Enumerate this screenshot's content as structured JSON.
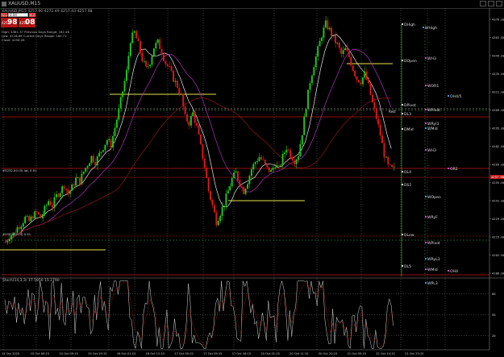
{
  "window": {
    "title": "XAUUSD,M15",
    "ohlc_line": "XAUUSD,M15  4257.90 4272.49 4257.43 4257.98"
  },
  "trade_panel": {
    "sell_label": "SELL",
    "buy_label": "BUY",
    "lot_value": "0.04",
    "sell_price_small": "4257",
    "sell_price_big": "98",
    "buy_price_small": "4258",
    "buy_price_big": "08",
    "info_lines": [
      "High: 4381.37    Previous Days Range: 162.46",
      "Low: 4216.89     Current Days Range: 160.71",
      "Close: 4256.28"
    ]
  },
  "price_axis": {
    "ticks": [
      "4376.00",
      "4362.00",
      "4349.00",
      "4335.00",
      "4321.00",
      "4309.00",
      "4295.00",
      "4282.00",
      "4269.00",
      "4255.00",
      "4241.00",
      "4229.00",
      "4215.00",
      "4202.00",
      "4188.00"
    ],
    "bid_label": "4257.98"
  },
  "time_axis": {
    "ticks": [
      "14 Oct 2025",
      "15 Oct 00:15",
      "15 Oct 09:15",
      "15 Oct 19:15",
      "16 Oct 01:15",
      "16 Oct 12:15",
      "17 Oct 00:15",
      "17 Oct 09:15",
      "17 Oct 18:15",
      "20 Oct 01:15",
      "20 Oct 11:15",
      "20 Oct 20:15",
      "21 Oct 05:15",
      "21 Oct 14:15",
      "21 Oct 23:15"
    ]
  },
  "level_labels": {
    "left": [
      "DHigh",
      "DOpen",
      "DPivot",
      "DL3",
      "DMid",
      "DL4",
      "DS1",
      "DLow",
      "DL5"
    ],
    "right": [
      "WHigh",
      "WH3",
      "WOR1",
      "OH4/5",
      "WPivot",
      "WRyl3",
      "WMid",
      "WH3",
      "OR2",
      "WOpen",
      "WRyF",
      "WPivot",
      "WRyL3",
      "WMid",
      "OH4",
      "WPL3"
    ],
    "mid": [
      "Rest"
    ]
  },
  "annotations": {
    "left_level_1": "#5232.00 (0) lot: 0.91",
    "left_level_2": "#5552.00 (0) 0.91"
  },
  "indicator": {
    "label": "Stoch(14,3,3) 17.5850 15.2790",
    "ticks": [
      "80",
      "50",
      "20"
    ]
  },
  "colors": {
    "bull": "#1fc91f",
    "bear": "#e01818",
    "ma_white": "#e6e6e6",
    "ma_violet": "#b030c0",
    "ma_darkred": "#8b1a1a",
    "yellow": "#e8e84a",
    "green_line": "#2e9e2e"
  },
  "chart_data": {
    "type": "candlestick",
    "ylim": [
      4170,
      4390
    ],
    "close_path": [
      4198,
      4203,
      4205,
      4210,
      4213,
      4218,
      4215,
      4220,
      4222,
      4218,
      4225,
      4232,
      4228,
      4236,
      4240,
      4245,
      4238,
      4243,
      4250,
      4248,
      4256,
      4262,
      4268,
      4264,
      4270,
      4276,
      4282,
      4278,
      4292,
      4306,
      4322,
      4338,
      4364,
      4370,
      4360,
      4348,
      4340,
      4346,
      4358,
      4362,
      4354,
      4345,
      4340,
      4332,
      4326,
      4318,
      4300,
      4296,
      4304,
      4292,
      4276,
      4260,
      4240,
      4228,
      4215,
      4222,
      4230,
      4240,
      4250,
      4255,
      4246,
      4240,
      4248,
      4258,
      4264,
      4268,
      4264,
      4258,
      4256,
      4262,
      4258,
      4268,
      4276,
      4270,
      4265,
      4270,
      4288,
      4310,
      4330,
      4344,
      4356,
      4368,
      4377,
      4372,
      4365,
      4360,
      4352,
      4356,
      4350,
      4340,
      4332,
      4330,
      4336,
      4326,
      4312,
      4300,
      4286,
      4270,
      4260,
      4258
    ],
    "candles_per_step": 2
  }
}
